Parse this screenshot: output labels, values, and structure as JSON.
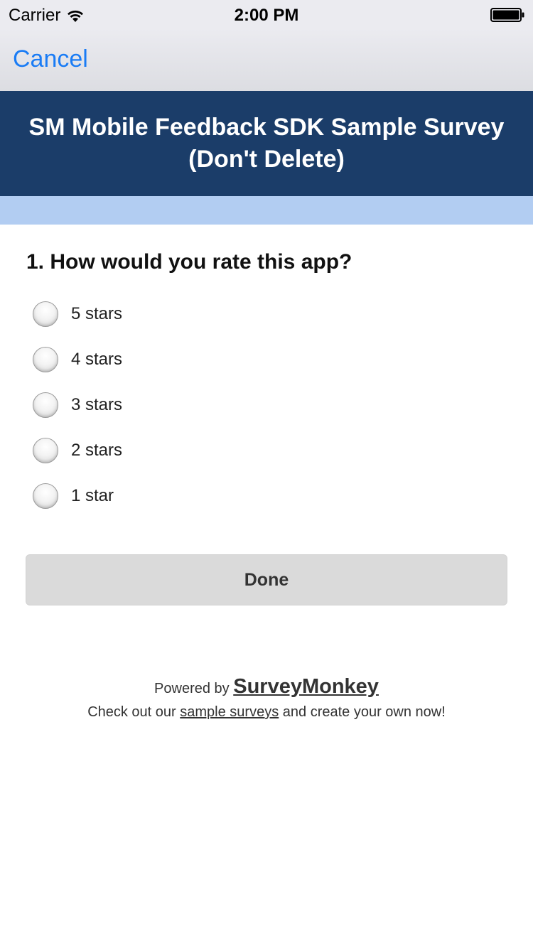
{
  "status_bar": {
    "carrier": "Carrier",
    "time": "2:00 PM"
  },
  "nav": {
    "cancel_label": "Cancel"
  },
  "survey": {
    "title": "SM Mobile Feedback SDK Sample Survey (Don't Delete)",
    "question": "1. How would you rate this app?",
    "options": [
      {
        "label": "5 stars",
        "selected": false
      },
      {
        "label": "4 stars",
        "selected": false
      },
      {
        "label": "3 stars",
        "selected": false
      },
      {
        "label": "2 stars",
        "selected": false
      },
      {
        "label": "1 star",
        "selected": false
      }
    ],
    "done_label": "Done"
  },
  "footer": {
    "powered_by": "Powered by",
    "brand": "SurveyMonkey",
    "cta_prefix": "Check out our",
    "cta_link": "sample surveys",
    "cta_suffix": "and create your own now!"
  },
  "colors": {
    "header_bg": "#1b3d69",
    "accent_link": "#1a7cf5",
    "progress_band": "#b2cdf2"
  }
}
